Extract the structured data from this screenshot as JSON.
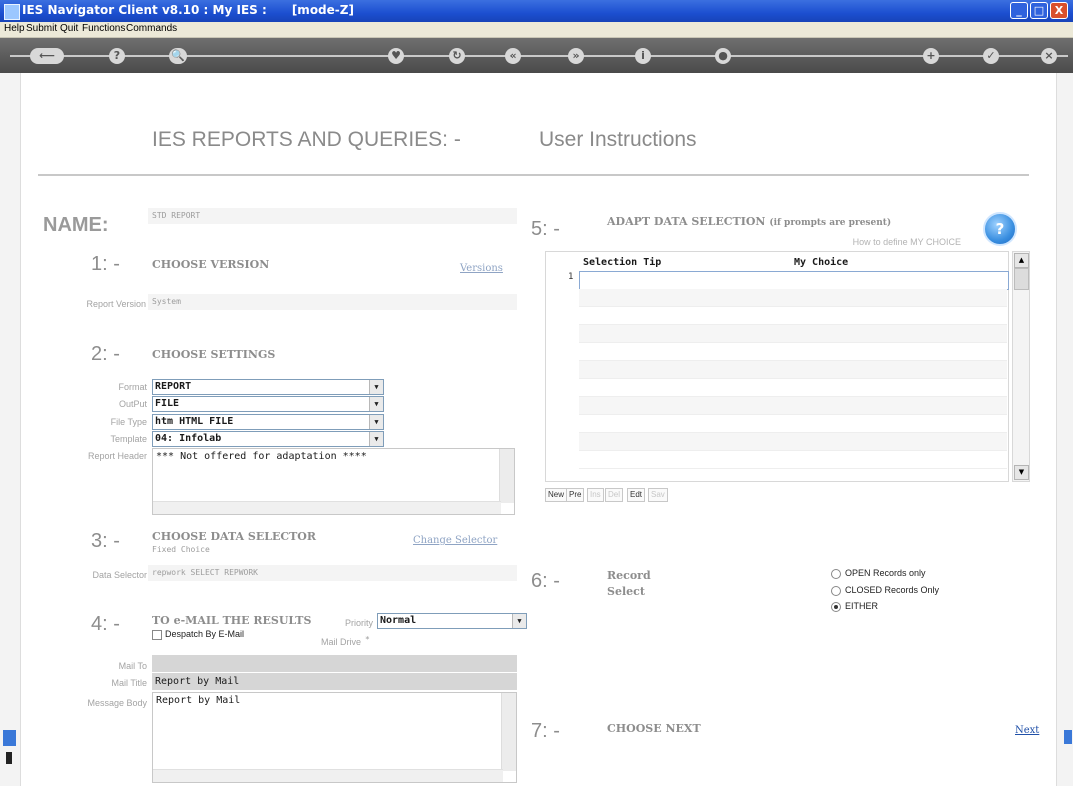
{
  "window": {
    "title": "IES Navigator Client v8.10 : My IES :      [mode-Z]",
    "min": "_",
    "max": "□",
    "close": "X"
  },
  "menu": [
    "Help",
    "Submit",
    "Quit",
    "Functions",
    "Commands"
  ],
  "toolbar": {
    "buttons": [
      {
        "icon": "back-arrow-icon",
        "glyph": "⟵"
      },
      {
        "icon": "help-icon",
        "glyph": "?"
      },
      {
        "icon": "search-icon",
        "glyph": "🔍"
      },
      {
        "icon": "heart-icon",
        "glyph": "♥"
      },
      {
        "icon": "refresh-icon",
        "glyph": "↻"
      },
      {
        "icon": "rewind-icon",
        "glyph": "«"
      },
      {
        "icon": "forward-icon",
        "glyph": "»"
      },
      {
        "icon": "info-icon",
        "glyph": "i"
      },
      {
        "icon": "circle-icon",
        "glyph": "●"
      },
      {
        "icon": "plus-icon",
        "glyph": "+"
      },
      {
        "icon": "check-icon",
        "glyph": "✓"
      },
      {
        "icon": "close-icon",
        "glyph": "×"
      }
    ]
  },
  "header": {
    "title": "IES REPORTS AND QUERIES: -",
    "subtitle": "User Instructions"
  },
  "name": {
    "label": "NAME:",
    "value": "STD REPORT"
  },
  "step1": {
    "num": "1: -",
    "label": "CHOOSE VERSION",
    "link": "Versions",
    "field_label": "Report Version",
    "value": "System"
  },
  "step2": {
    "num": "2: -",
    "label": "CHOOSE SETTINGS",
    "format_label": "Format",
    "format": "REPORT",
    "output_label": "OutPut",
    "output": "FILE",
    "filetype_label": "File Type",
    "filetype": "htm HTML FILE",
    "template_label": "Template",
    "template": "04: Infolab",
    "header_label": "Report Header",
    "header_text": "*** Not offered for adaptation ****"
  },
  "step3": {
    "num": "3: -",
    "label": "CHOOSE DATA SELECTOR",
    "sub": "Fixed Choice",
    "link": "Change Selector",
    "field_label": "Data Selector",
    "value": "repwork SELECT REPWORK"
  },
  "step4": {
    "num": "4: -",
    "label": "TO e-MAIL THE RESULTS",
    "priority_label": "Priority",
    "priority": "Normal",
    "despatch": "Despatch By E-Mail",
    "maildrive_label": "Mail Drive",
    "maildrive": "*",
    "mailto_label": "Mail To",
    "mailto": "",
    "mailtitle_label": "Mail Title",
    "mailtitle": "Report by Mail",
    "body_label": "Message Body",
    "body": "Report by Mail"
  },
  "step5": {
    "num": "5: -",
    "label": "ADAPT DATA SELECTION",
    "label_note": "(if prompts are present)",
    "how_to": "How to define MY CHOICE",
    "col_tip": "Selection Tip",
    "col_choice": "My Choice",
    "row1": "1",
    "buttons": {
      "new": "New",
      "pre": "Pre",
      "ins": "Ins",
      "del": "Del",
      "edit": "Edt",
      "sav": "Sav"
    }
  },
  "step6": {
    "num": "6: -",
    "label_line1": "Record",
    "label_line2": "Select",
    "options": [
      "OPEN Records only",
      "CLOSED Records Only",
      "EITHER"
    ],
    "selected": "EITHER"
  },
  "step7": {
    "num": "7: -",
    "label": "CHOOSE NEXT",
    "link": "Next"
  }
}
